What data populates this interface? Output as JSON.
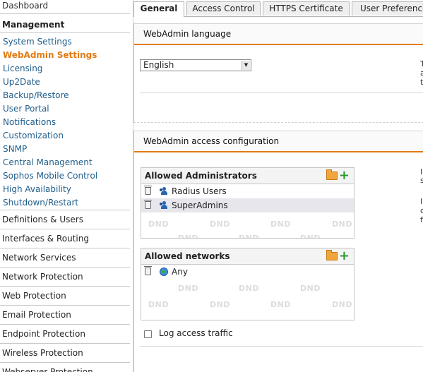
{
  "sidebar": {
    "dashboard": "Dashboard",
    "management": {
      "header": "Management",
      "items": [
        "System Settings",
        "WebAdmin Settings",
        "Licensing",
        "Up2Date",
        "Backup/Restore",
        "User Portal",
        "Notifications",
        "Customization",
        "SNMP",
        "Central Management",
        "Sophos Mobile Control",
        "High Availability",
        "Shutdown/Restart"
      ],
      "active_item": "WebAdmin Settings"
    },
    "sections": [
      "Definitions & Users",
      "Interfaces & Routing",
      "Network Services",
      "Network Protection",
      "Web Protection",
      "Email Protection",
      "Endpoint Protection",
      "Wireless Protection",
      "Webserver Protection"
    ]
  },
  "tabs": [
    "General",
    "Access Control",
    "HTTPS Certificate",
    "User Preferences"
  ],
  "active_tab": "General",
  "language_panel": {
    "title": "WebAdmin language",
    "selected_language": "English",
    "right_text_fragments": [
      "T",
      "a",
      "t"
    ]
  },
  "access_panel": {
    "title": "WebAdmin access configuration",
    "administrators": {
      "title": "Allowed Administrators",
      "items": [
        "Radius Users",
        "SuperAdmins"
      ]
    },
    "networks": {
      "title": "Allowed networks",
      "items": [
        "Any"
      ]
    },
    "dnd_label": "DND",
    "log_access_label": "Log access traffic",
    "log_access_checked": false,
    "right_text_fragments": [
      "I",
      "s",
      "I",
      "c",
      "f"
    ]
  },
  "colors": {
    "accent": "#e17a12",
    "link": "#1f5e8c",
    "add_icon": "#2e9a2e",
    "folder_icon": "#f0a63c"
  }
}
